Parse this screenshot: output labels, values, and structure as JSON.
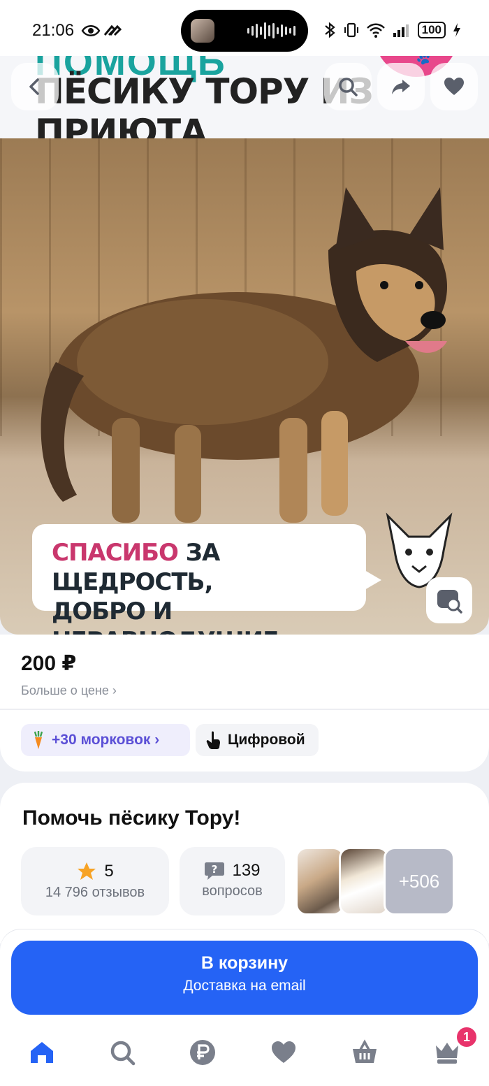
{
  "status_bar": {
    "time": "21:06",
    "battery": "100"
  },
  "banner": {
    "top_text": "ПОМОЩЬ",
    "title": "ПЁСИКУ ТОРУ ИЗ ПРИЮТА"
  },
  "photo": {
    "caption_highlight": "СПАСИБО",
    "caption_rest_line1": " ЗА ЩЕДРОСТЬ,",
    "caption_line2": "ДОБРО И НЕРАВНОДУШИЕ"
  },
  "price": {
    "value": "200 ₽",
    "more_label": "Больше о цене ›",
    "chips": [
      {
        "label": "+30 морковок ›",
        "icon": "carrot-icon"
      },
      {
        "label": "Цифровой",
        "icon": "touch-icon"
      }
    ]
  },
  "product": {
    "title": "Помочь пёсику Тору!",
    "rating": "5",
    "reviews": "14 796 отзывов",
    "questions_count": "139",
    "questions_label": "вопросов",
    "more_photos": "+506"
  },
  "cart": {
    "label": "В корзину",
    "sublabel": "Доставка на email"
  },
  "nav": {
    "items": [
      "home-icon",
      "search-icon",
      "ruble-icon",
      "heart-icon",
      "basket-icon",
      "profile-crown-icon"
    ],
    "badge": "1"
  },
  "colors": {
    "accent": "#2563f5",
    "carrot_chip_text": "#5b4fd6",
    "badge": "#e8336b",
    "caption_highlight": "#c9376d",
    "star": "#f7a325"
  }
}
